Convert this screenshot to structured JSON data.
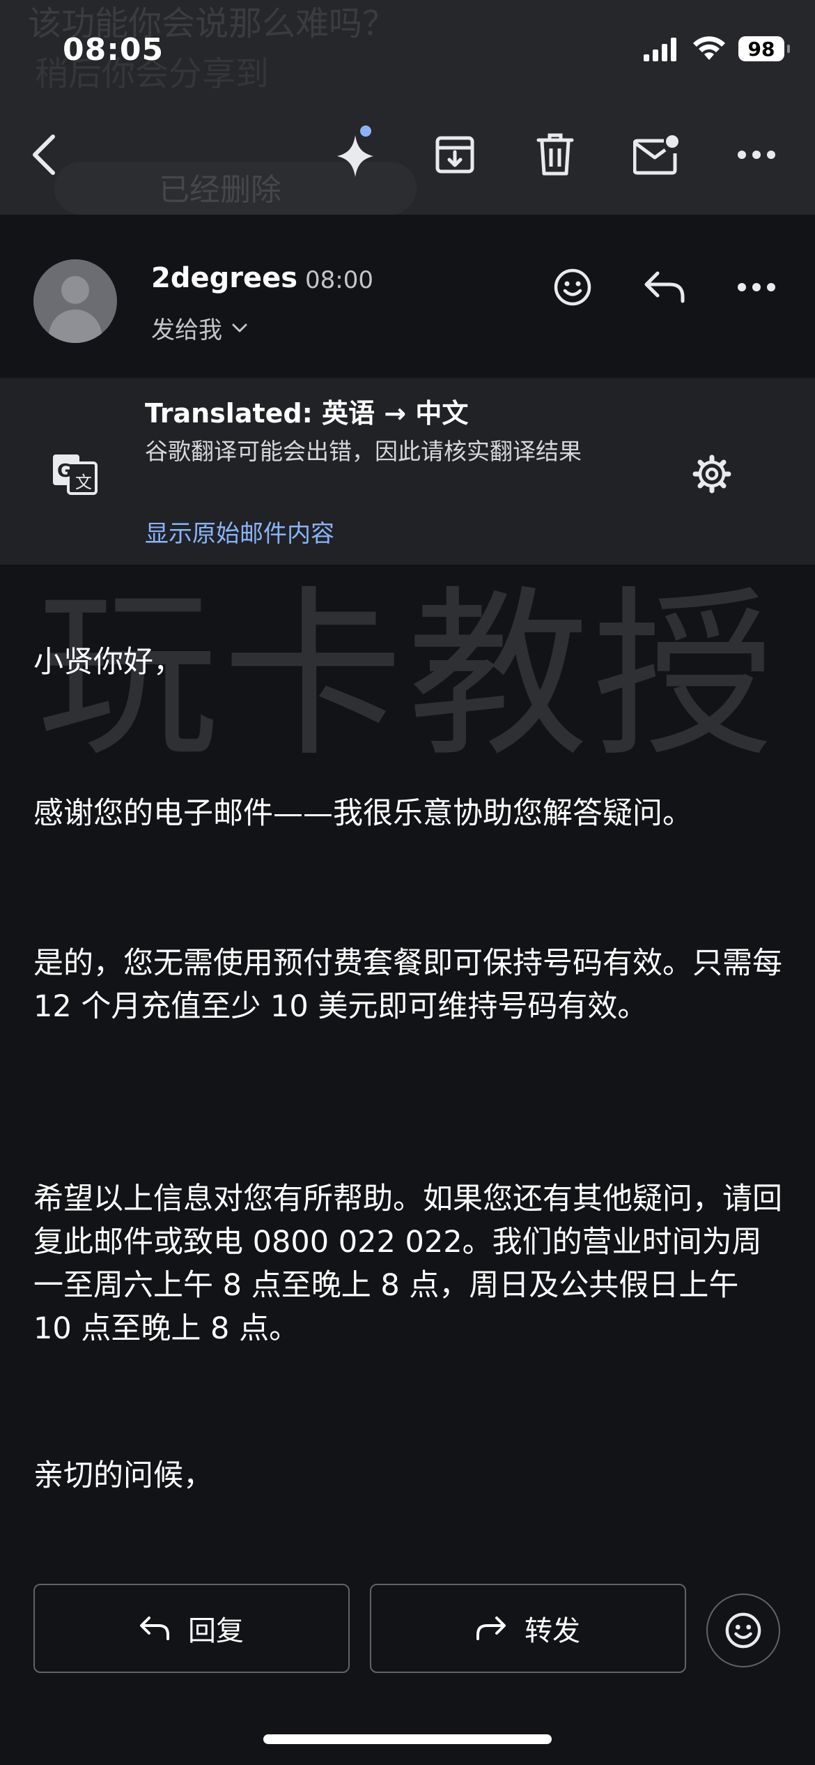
{
  "status_bar": {
    "time": "08:05",
    "battery": "98"
  },
  "toolbar": {
    "icons": [
      "back-arrow-icon",
      "gemini-sparkle-icon",
      "archive-icon",
      "trash-icon",
      "mark-unread-icon",
      "more-icon"
    ]
  },
  "background_ghost": {
    "line1": "该功能你会说那么难吗？",
    "line2": "稍后你会分享到",
    "chip": "已经删除"
  },
  "sender": {
    "name": "2degrees",
    "time": "08:00",
    "recipient_label": "发给我"
  },
  "translation": {
    "title": "Translated: 英语 → 中文",
    "note": "谷歌翻译可能会出错，因此请核实翻译结果",
    "show_original": "显示原始邮件内容"
  },
  "watermark": "玩卡教授",
  "body": {
    "greeting": "小贤你好，",
    "para1": "感谢您的电子邮件——我很乐意协助您解答疑问。",
    "para2": "是的，您无需使用预付费套餐即可保持号码有效。只需每 12 个月充值至少 10 美元即可维持号码有效。",
    "para3": "希望以上信息对您有所帮助。如果您还有其他疑问，请回复此邮件或致电 0800 022 022。我们的营业时间为周一至周六上午 8 点至晚上 8 点，周日及公共假日上午 10 点至晚上 8 点。",
    "closing": "亲切的问候，"
  },
  "actions": {
    "reply": "回复",
    "forward": "转发"
  },
  "colors": {
    "background": "#121316",
    "toolbar": "#25272b",
    "panel": "#202226",
    "link": "#8ab4f8",
    "accent_dot": "#8ab4f8"
  }
}
